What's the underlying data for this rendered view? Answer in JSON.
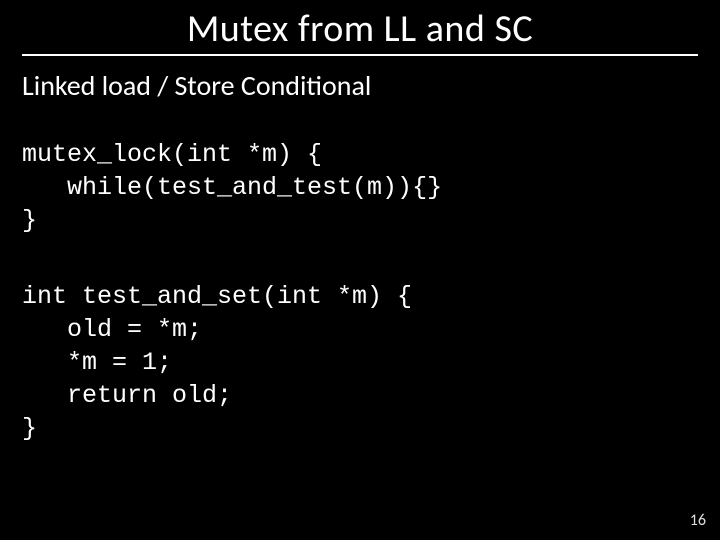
{
  "slide": {
    "title": "Mutex from LL and SC",
    "subtitle": "Linked load / Store Conditional",
    "code1": "mutex_lock(int *m) {\n   while(test_and_test(m)){}\n}",
    "code2": "int test_and_set(int *m) {\n   old = *m;\n   *m = 1;\n   return old;\n}",
    "page_number": "16"
  }
}
